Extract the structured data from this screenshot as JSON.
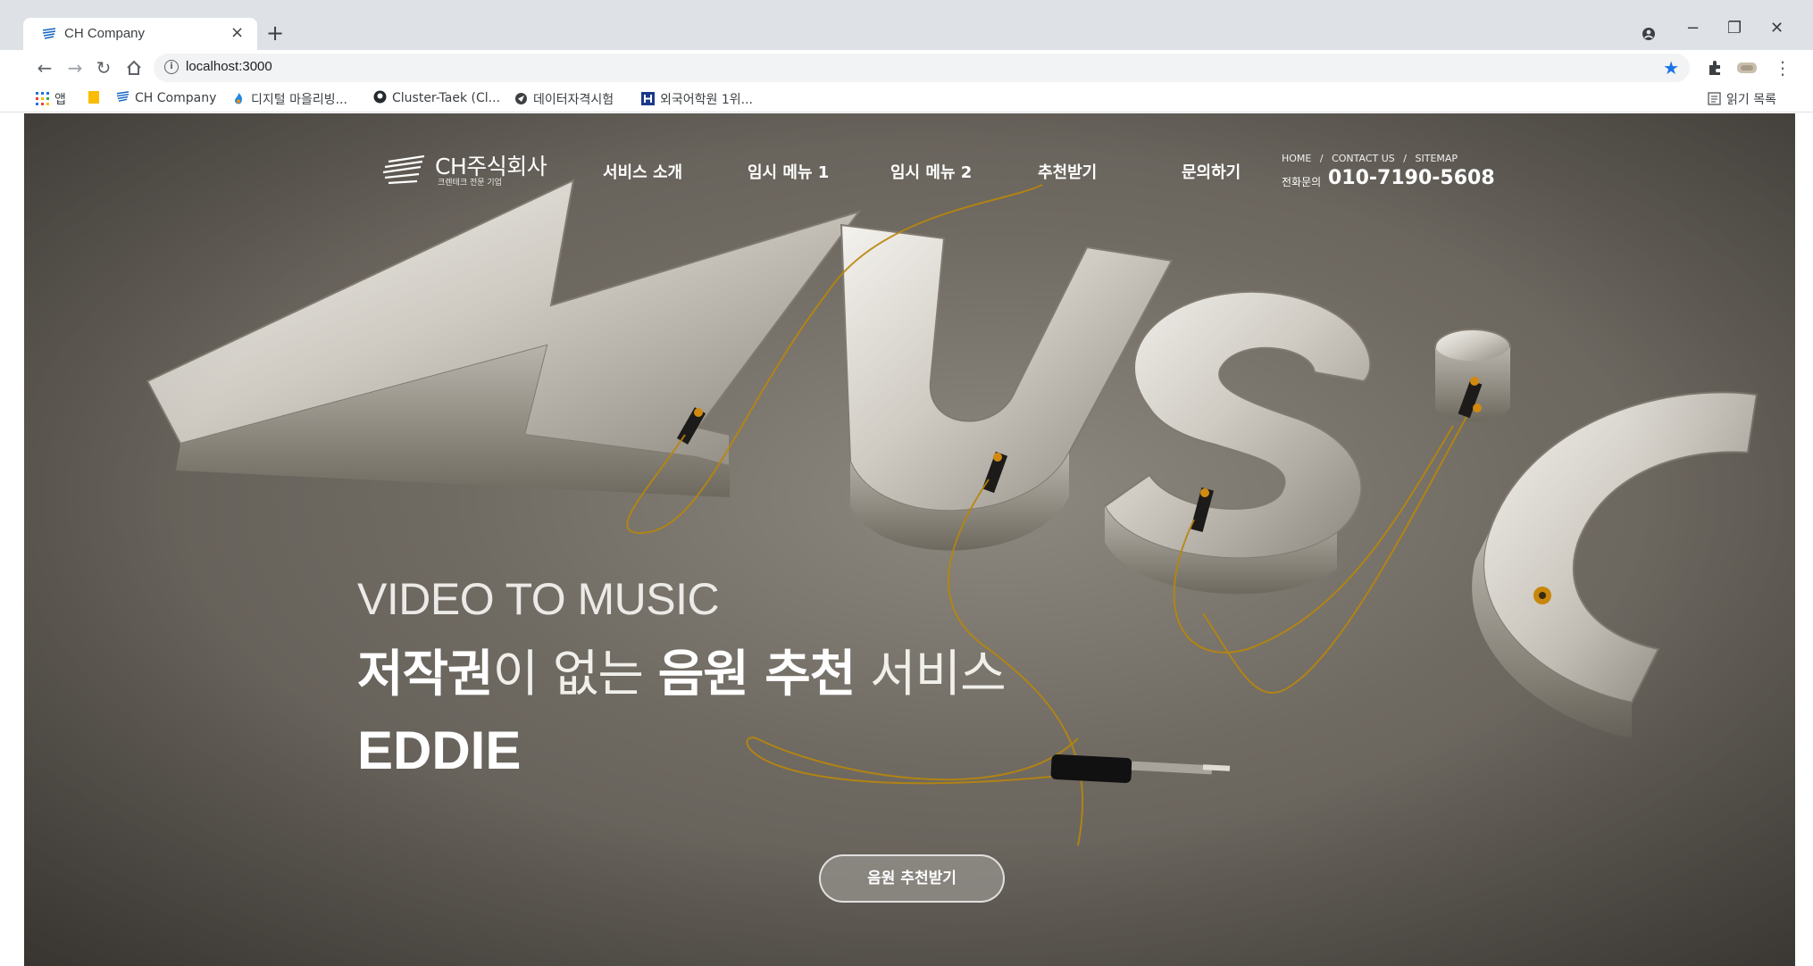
{
  "browser": {
    "tab_title": "CH Company",
    "tab_close": "×",
    "new_tab": "+",
    "url": "localhost:3000",
    "window_controls": {
      "minimize": "−",
      "restore": "❐",
      "close": "✕"
    },
    "bookmarks": {
      "apps": "앱",
      "items": [
        "CH Company",
        "디지털 마을리빙...",
        "Cluster-Taek (Cl...",
        "데이터자격시험",
        "외국어학원 1위..."
      ],
      "reading_list": "읽기 목록"
    },
    "icons": [
      "back-icon",
      "forward-icon",
      "reload-icon",
      "home-icon",
      "info-icon",
      "star-icon",
      "extensions-icon",
      "profile-icon",
      "menu-icon"
    ]
  },
  "site": {
    "logo": {
      "name": "CH주식회사",
      "tagline": "크렌테크 전문 기업"
    },
    "menu": [
      "서비스 소개",
      "임시 메뉴 1",
      "임시 메뉴 2",
      "추천받기",
      "문의하기"
    ],
    "util_links": [
      "HOME",
      "CONTACT US",
      "SITEMAP"
    ],
    "util_separator": "/",
    "phone_label": "전화문의",
    "phone_number": "010-7190-5608"
  },
  "hero": {
    "subtitle": "VIDEO TO MUSIC",
    "title_parts": [
      "저작권",
      "이 없는 ",
      "음원 추천",
      " 서비스"
    ],
    "brand": "EDDIE",
    "cta_label": "음원 추천받기"
  },
  "colors": {
    "accent_blue": "#1a73e8",
    "hero_bg": "#6f6a62",
    "text_white": "#ffffff"
  }
}
